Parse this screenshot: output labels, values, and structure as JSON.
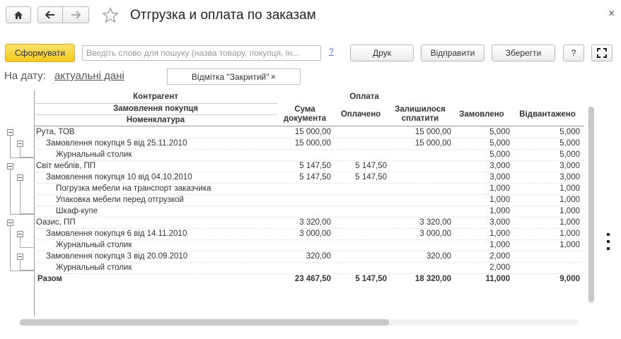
{
  "window": {
    "title": "Отгрузка и оплата по заказам",
    "close_glyph": "×"
  },
  "toolbar": {
    "home_icon": "home-icon",
    "back_icon": "arrow-left-icon",
    "forward_icon": "arrow-right-icon",
    "star_icon": "star-icon",
    "generate_label": "Сформувати",
    "search_placeholder": "Введіть слово для пошуку (назва товару, покупця, ін...",
    "help_link": "?",
    "print_label": "Друк",
    "send_label": "Відправити",
    "save_label": "Зберегти",
    "help_label": "?",
    "fullscreen_icon": "fullscreen-icon"
  },
  "filters": {
    "date_label": "На дату:",
    "date_value": "актуальні дані",
    "closed_mark": "Відмітка \"Закритий\"",
    "closed_mark_remove": "×"
  },
  "table": {
    "headers": {
      "counterparty": "Контрагент",
      "payment_group": "Оплата",
      "order": "Замовлення покупця",
      "nomenclature": "Номенклатура",
      "doc_sum_1": "Сума",
      "doc_sum_2": "документа",
      "paid": "Оплачено",
      "remaining_1": "Залишилося",
      "remaining_2": "сплатити",
      "ordered": "Замовлено",
      "shipped": "Відвантажено"
    },
    "rows": [
      {
        "level": 0,
        "name": "Рута, ТОВ",
        "sum": "15 000,00",
        "paid": "",
        "remaining": "15 000,00",
        "ordered": "5,000",
        "shipped": "5,000"
      },
      {
        "level": 1,
        "name": "Замовлення покупця 5 від 25.11.2010",
        "sum": "15 000,00",
        "paid": "",
        "remaining": "15 000,00",
        "ordered": "5,000",
        "shipped": "5,000"
      },
      {
        "level": 2,
        "name": "Журнальный столик",
        "sum": "",
        "paid": "",
        "remaining": "",
        "ordered": "5,000",
        "shipped": "5,000"
      },
      {
        "level": 0,
        "name": "Світ меблів, ПП",
        "sum": "5 147,50",
        "paid": "5 147,50",
        "remaining": "",
        "ordered": "3,000",
        "shipped": "3,000"
      },
      {
        "level": 1,
        "name": "Замовлення покупця 10 від 04.10.2010",
        "sum": "5 147,50",
        "paid": "5 147,50",
        "remaining": "",
        "ordered": "3,000",
        "shipped": "3,000"
      },
      {
        "level": 2,
        "name": "Погрузка мебели на транспорт заказчика",
        "sum": "",
        "paid": "",
        "remaining": "",
        "ordered": "1,000",
        "shipped": "1,000"
      },
      {
        "level": 2,
        "name": "Упаковка мебели перед отгрузкой",
        "sum": "",
        "paid": "",
        "remaining": "",
        "ordered": "1,000",
        "shipped": "1,000"
      },
      {
        "level": 2,
        "name": "Шкаф-купе",
        "sum": "",
        "paid": "",
        "remaining": "",
        "ordered": "1,000",
        "shipped": "1,000"
      },
      {
        "level": 0,
        "name": "Оазис, ПП",
        "sum": "3 320,00",
        "paid": "",
        "remaining": "3 320,00",
        "ordered": "3,000",
        "shipped": "1,000"
      },
      {
        "level": 1,
        "name": "Замовлення покупця 6 від 14.11.2010",
        "sum": "3 000,00",
        "paid": "",
        "remaining": "3 000,00",
        "ordered": "1,000",
        "shipped": "1,000"
      },
      {
        "level": 2,
        "name": "Журнальный столик",
        "sum": "",
        "paid": "",
        "remaining": "",
        "ordered": "1,000",
        "shipped": "1,000"
      },
      {
        "level": 1,
        "name": "Замовлення покупця 3 від 20.09.2010",
        "sum": "320,00",
        "paid": "",
        "remaining": "320,00",
        "ordered": "2,000",
        "shipped": ""
      },
      {
        "level": 2,
        "name": "Журнальный столик",
        "sum": "",
        "paid": "",
        "remaining": "",
        "ordered": "2,000",
        "shipped": ""
      }
    ],
    "total": {
      "name": "Разом",
      "sum": "23 467,50",
      "paid": "5 147,50",
      "remaining": "18 320,00",
      "ordered": "11,000",
      "shipped": "9,000"
    }
  },
  "colors": {
    "accent_button": "#f5d02d",
    "link": "#4a6ed0",
    "grid_line": "#999999"
  }
}
